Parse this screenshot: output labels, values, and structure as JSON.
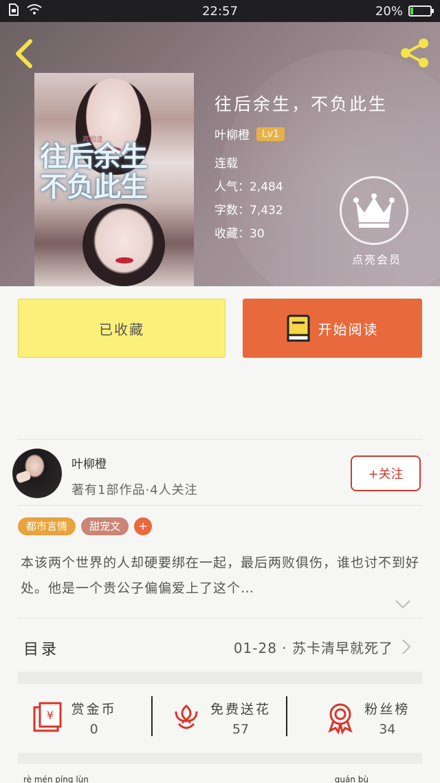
{
  "status_bar": {
    "time": "22:57",
    "battery_percent": "20%",
    "battery_level": 0.2
  },
  "book": {
    "title": "往后余生，不负此生",
    "author": "叶柳橙",
    "level": "Lv1",
    "status": "连载",
    "popularity": "人气：2,484",
    "word_count": "字数：7,432",
    "favorites": "收藏：30",
    "cover_title_art": "往后余生\n不负此生",
    "cover_subtitle_art": "再相逢"
  },
  "member_badge": {
    "label": "点亮会员",
    "icon": "crown-icon"
  },
  "actions": {
    "collected_label": "已收藏",
    "read_label": "开始阅读"
  },
  "author_card": {
    "name": "叶柳橙",
    "description": "著有1部作品·4人关注",
    "follow_label": "+关注"
  },
  "tags": [
    "都市言情",
    "甜宠文",
    "+"
  ],
  "synopsis": "本该两个世界的人却硬要绑在一起，最后两败俱伤，谁也讨不到好处。他是一个贵公子偏偏爱上了这个…",
  "toc": {
    "label": "目录",
    "latest": "01-28 · 苏卡清早就死了"
  },
  "rewards": [
    {
      "label": "赏金币",
      "value": "0",
      "icon": "red-envelope-icon"
    },
    {
      "label": "免费送花",
      "value": "57",
      "icon": "flower-icon"
    },
    {
      "label": "粉丝榜",
      "value": "34",
      "icon": "medal-icon"
    }
  ],
  "footer_partial": {
    "left": "rè mén píng lùn",
    "right": "quán bù"
  },
  "colors": {
    "accent_orange": "#e8693c",
    "collect_yellow": "#fbf07a",
    "follow_red": "#cc3b2e",
    "level_gold": "#e8b04a",
    "share_yellow": "#f5e34a"
  }
}
